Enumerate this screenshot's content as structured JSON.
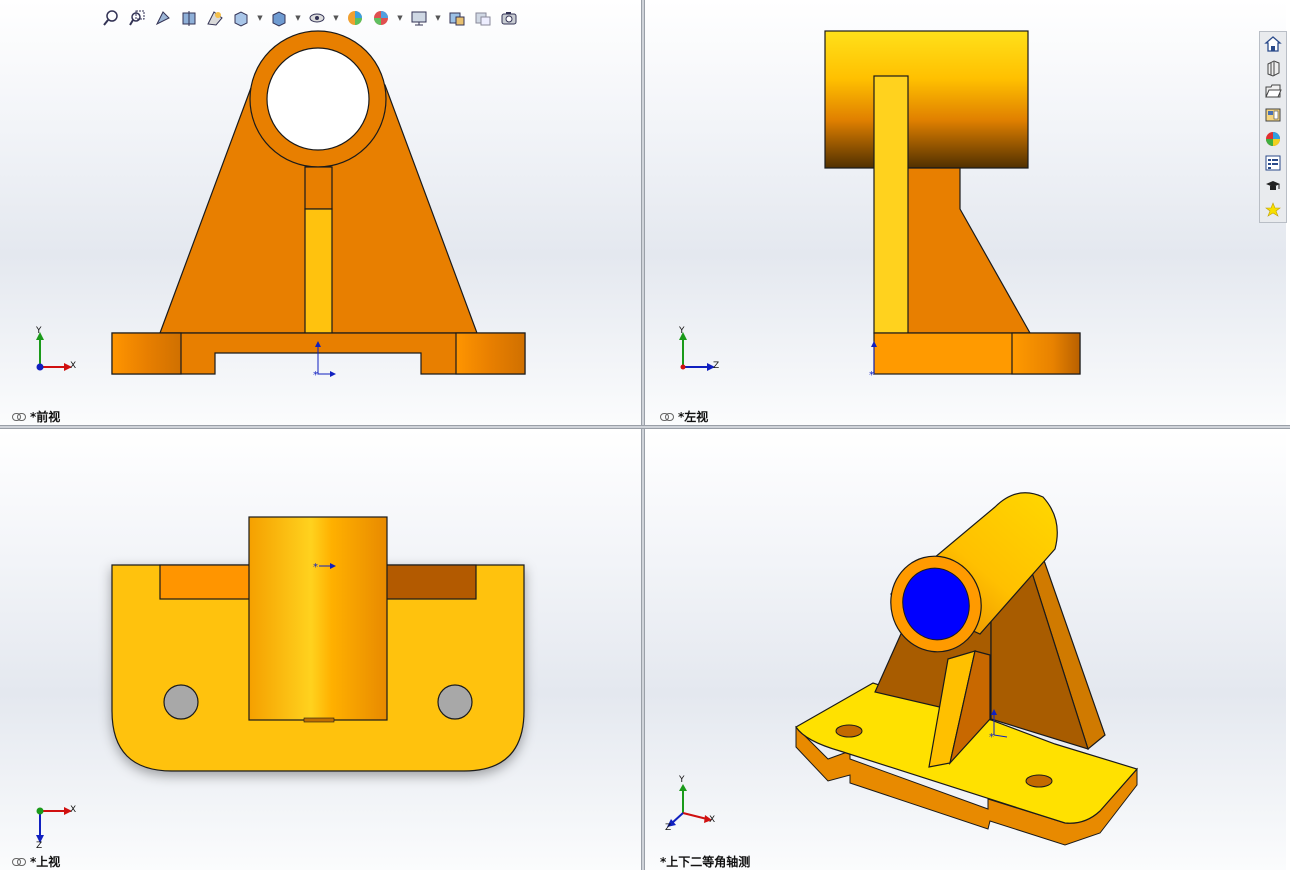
{
  "views": {
    "front": {
      "label": "*前视"
    },
    "left": {
      "label": "*左视"
    },
    "top": {
      "label": "*上视"
    },
    "iso": {
      "label": "*上下二等角轴测"
    }
  },
  "axes": {
    "x": "X",
    "y": "Y",
    "z": "Z"
  },
  "toolbar": {
    "items": [
      "zoom-to-fit-icon",
      "zoom-to-area-icon",
      "previous-view-icon",
      "section-view-icon",
      "dynamic-annotation-icon",
      "view-orientation-icon",
      "display-style-icon",
      "hide-show-items-icon",
      "edit-appearance-icon",
      "apply-scene-icon",
      "view-settings-icon",
      "display-pane-icon",
      "camera-icon"
    ]
  },
  "taskpane": {
    "items": [
      "home-icon",
      "parts-library-icon",
      "file-explorer-icon",
      "view-palette-icon",
      "appearances-icon",
      "custom-properties-icon",
      "tutorial-icon",
      "favorites-icon"
    ]
  },
  "colors": {
    "orange": "#e87f00",
    "gold": "#ffc20e",
    "yellow": "#ffd21e",
    "blue": "#0000ff",
    "edge": "#1a1a1a"
  }
}
